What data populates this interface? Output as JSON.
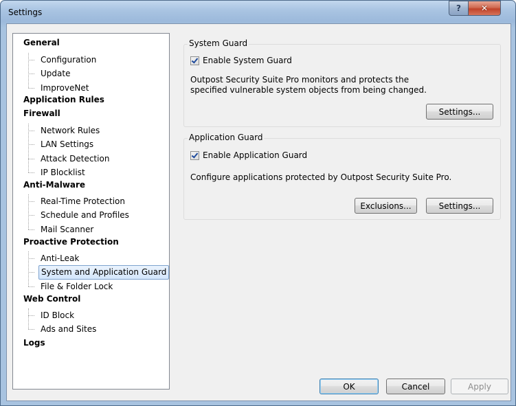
{
  "window": {
    "title": "Settings",
    "help_label": "?",
    "close_label": "✕"
  },
  "tree": {
    "items": [
      {
        "label": "General",
        "level": 0
      },
      {
        "label": "Configuration",
        "level": 1
      },
      {
        "label": "Update",
        "level": 1
      },
      {
        "label": "ImproveNet",
        "level": 1
      },
      {
        "label": "Application Rules",
        "level": 0
      },
      {
        "label": "Firewall",
        "level": 0
      },
      {
        "label": "Network Rules",
        "level": 1
      },
      {
        "label": "LAN Settings",
        "level": 1
      },
      {
        "label": "Attack Detection",
        "level": 1
      },
      {
        "label": "IP Blocklist",
        "level": 1
      },
      {
        "label": "Anti-Malware",
        "level": 0
      },
      {
        "label": "Real-Time Protection",
        "level": 1
      },
      {
        "label": "Schedule and Profiles",
        "level": 1
      },
      {
        "label": "Mail Scanner",
        "level": 1
      },
      {
        "label": "Proactive Protection",
        "level": 0
      },
      {
        "label": "Anti-Leak",
        "level": 1
      },
      {
        "label": "System and Application Guard",
        "level": 1,
        "selected": true
      },
      {
        "label": "File & Folder Lock",
        "level": 1
      },
      {
        "label": "Web Control",
        "level": 0
      },
      {
        "label": "ID Block",
        "level": 1
      },
      {
        "label": "Ads and Sites",
        "level": 1
      },
      {
        "label": "Logs",
        "level": 0
      }
    ]
  },
  "system_guard": {
    "title": "System Guard",
    "checkbox_label": "Enable System Guard",
    "checked": true,
    "description_line1": "Outpost Security Suite Pro monitors and protects the",
    "description_line2": "specified vulnerable system objects from being changed.",
    "settings_button": "Settings..."
  },
  "application_guard": {
    "title": "Application Guard",
    "checkbox_label": "Enable Application Guard",
    "checked": true,
    "description": "Configure applications protected by Outpost Security Suite Pro.",
    "exclusions_button": "Exclusions...",
    "settings_button": "Settings..."
  },
  "footer": {
    "ok": "OK",
    "cancel": "Cancel",
    "apply": "Apply"
  }
}
